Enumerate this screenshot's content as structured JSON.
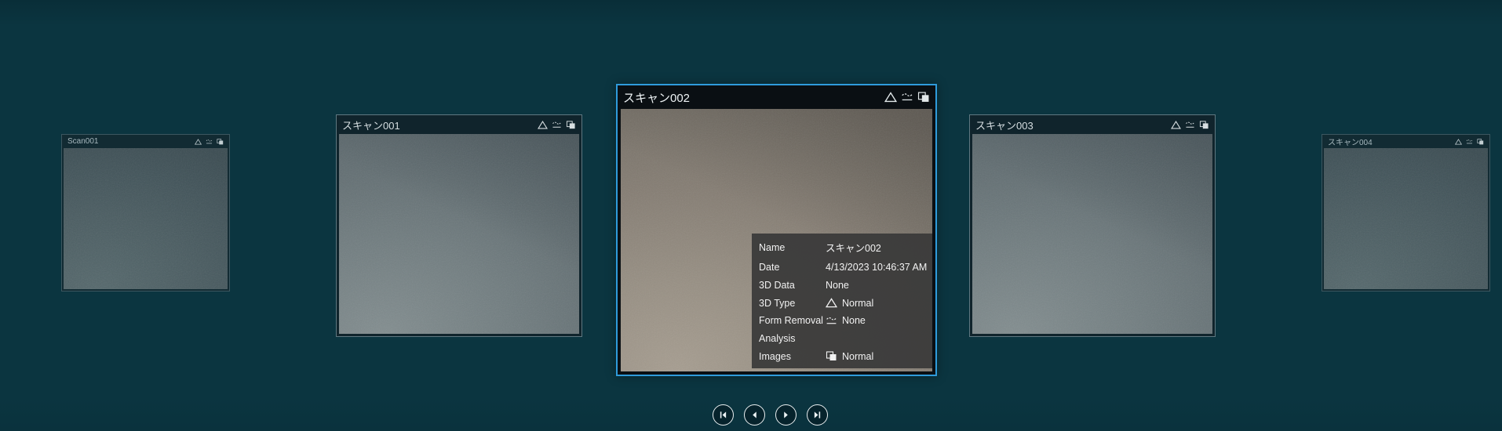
{
  "window": {
    "background": "#0b3540",
    "accent": "#2f9bdb",
    "panel_color": "#383838"
  },
  "cards": [
    {
      "title": "Scan001",
      "selected": false,
      "size": "far"
    },
    {
      "title": "スキャン001",
      "selected": false,
      "size": "near"
    },
    {
      "title": "スキャン002",
      "selected": true,
      "size": "center"
    },
    {
      "title": "スキャン003",
      "selected": false,
      "size": "near"
    },
    {
      "title": "スキャン004",
      "selected": false,
      "size": "far"
    }
  ],
  "badge_icons": [
    "triangle-3d-type-icon",
    "form-removal-icon",
    "images-icon"
  ],
  "info_panel": {
    "rows": [
      {
        "label": "Name",
        "value": "スキャン002"
      },
      {
        "label": "Date",
        "value": "4/13/2023 10:46:37 AM"
      },
      {
        "label": "3D Data",
        "value": "None"
      },
      {
        "label": "3D Type",
        "value": "Normal",
        "icon": "triangle-3d-type-icon"
      },
      {
        "label": "Form Removal",
        "value": "None",
        "icon": "form-removal-icon"
      },
      {
        "label": "Analysis",
        "value": ""
      },
      {
        "label": "Images",
        "value": "Normal",
        "icon": "images-icon"
      }
    ]
  },
  "navigation": {
    "buttons": [
      {
        "icon": "skip-to-first-icon"
      },
      {
        "icon": "previous-icon"
      },
      {
        "icon": "next-icon"
      },
      {
        "icon": "skip-to-last-icon"
      }
    ]
  }
}
